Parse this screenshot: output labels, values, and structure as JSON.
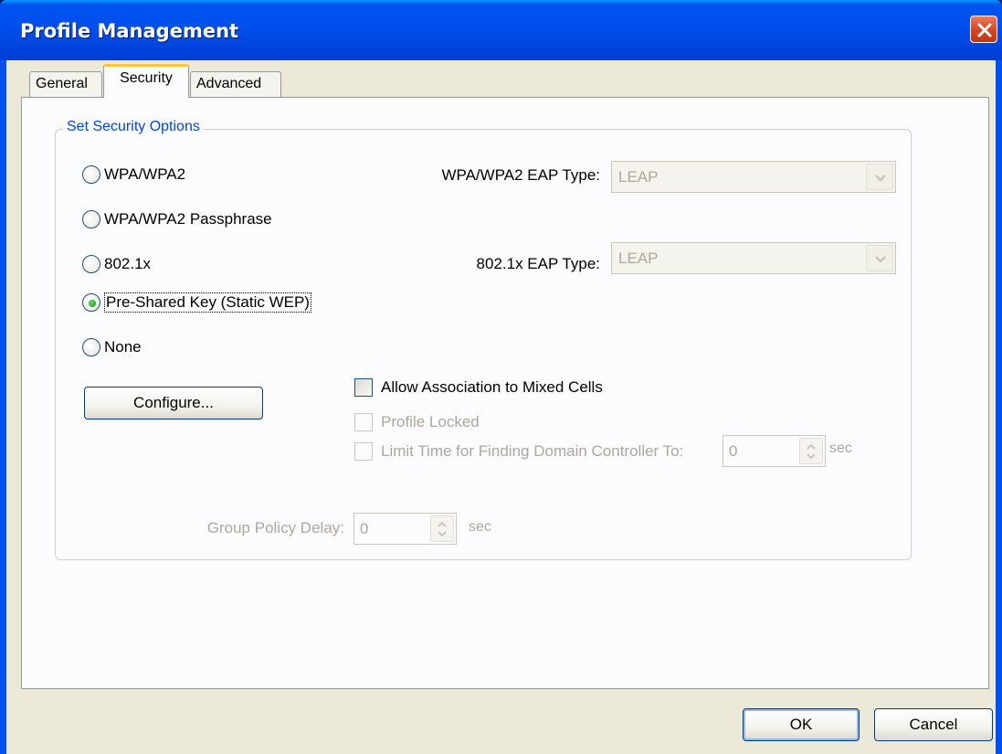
{
  "window": {
    "title": "Profile Management"
  },
  "tabs": [
    {
      "label": "General",
      "active": false
    },
    {
      "label": "Security",
      "active": true
    },
    {
      "label": "Advanced",
      "active": false
    }
  ],
  "security": {
    "group_title": "Set Security Options",
    "options": [
      {
        "label": "WPA/WPA2",
        "selected": false
      },
      {
        "label": "WPA/WPA2 Passphrase",
        "selected": false
      },
      {
        "label": "802.1x",
        "selected": false
      },
      {
        "label": "Pre-Shared Key (Static WEP)",
        "selected": true
      },
      {
        "label": "None",
        "selected": false
      }
    ],
    "wpa_eap_label": "WPA/WPA2 EAP Type:",
    "wpa_eap_value": "LEAP",
    "dot1x_eap_label": "802.1x EAP Type:",
    "dot1x_eap_value": "LEAP",
    "configure_label": "Configure...",
    "allow_mixed_label": "Allow Association to Mixed Cells",
    "allow_mixed_checked": false,
    "profile_locked_label": "Profile Locked",
    "limit_time_label": "Limit Time for Finding Domain Controller To:",
    "limit_time_value": "0",
    "limit_time_unit": "sec",
    "group_policy_label": "Group Policy Delay:",
    "group_policy_value": "0",
    "group_policy_unit": "sec"
  },
  "footer": {
    "ok_label": "OK",
    "cancel_label": "Cancel"
  }
}
